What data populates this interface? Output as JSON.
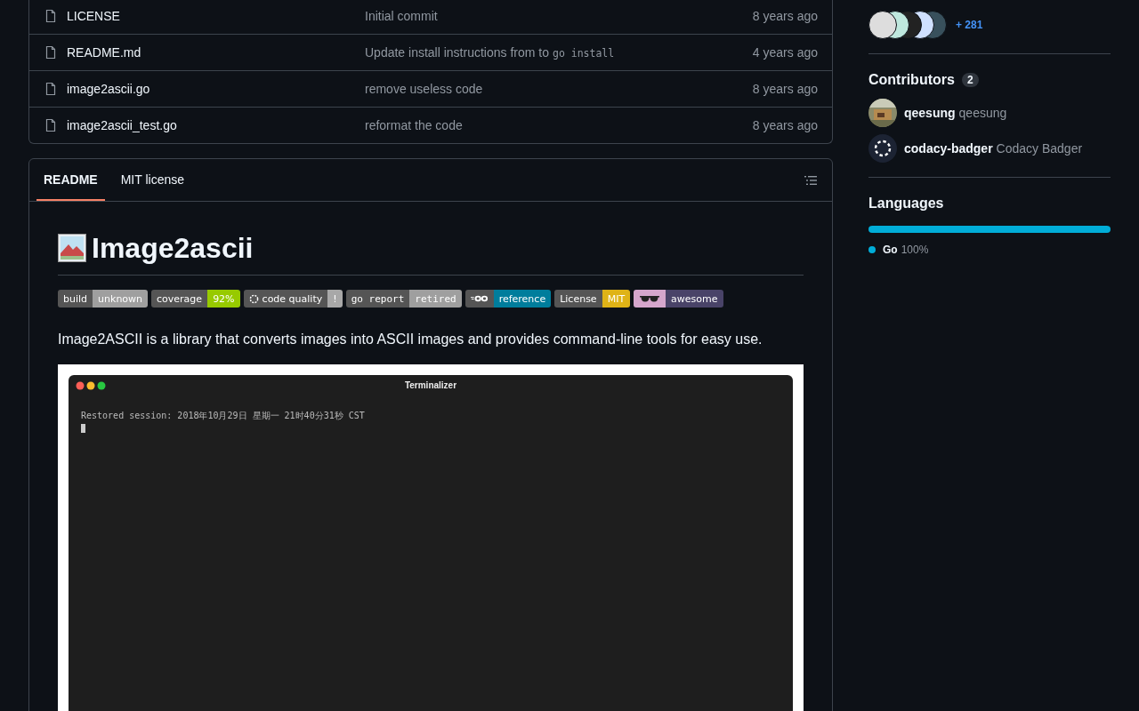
{
  "files": [
    {
      "name": "LICENSE",
      "message": "Initial commit",
      "time": "8 years ago"
    },
    {
      "name": "README.md",
      "message": "Update install instructions from to",
      "code": "go install",
      "time": "4 years ago"
    },
    {
      "name": "image2ascii.go",
      "message": "remove useless code",
      "time": "8 years ago"
    },
    {
      "name": "image2ascii_test.go",
      "message": "reformat the code",
      "time": "8 years ago"
    }
  ],
  "readme": {
    "tabs": [
      {
        "label": "README",
        "selected": true
      },
      {
        "label": "MIT license",
        "selected": false
      }
    ],
    "heading": "Image2ascii",
    "badges": [
      {
        "kind": "plain",
        "label": "build",
        "value": "unknown",
        "color": "#9f9f9f"
      },
      {
        "kind": "plain",
        "label": "coverage",
        "value": "92%",
        "color": "#97ca00"
      },
      {
        "kind": "codacy",
        "label": "code quality",
        "value": "!",
        "color": "#a8a8a8"
      },
      {
        "kind": "plain",
        "label": "go report",
        "value": "retired",
        "color": "#9f9f9f"
      },
      {
        "kind": "go",
        "value": "reference",
        "color": "#007d9c"
      },
      {
        "kind": "plain",
        "label": "License",
        "value": "MIT",
        "color": "#dfb317"
      },
      {
        "kind": "glasses",
        "value": "awesome",
        "color": "#494368"
      }
    ],
    "paragraph": "Image2ASCII is a library that converts images into ASCII images and provides command-line tools for easy use.",
    "terminal": {
      "title": "Terminalizer",
      "line": "Restored session: 2018年10月29日 星期一 21时40分31秒 CST"
    }
  },
  "sidebar": {
    "contributors_more": "+ 281",
    "contributors": {
      "title": "Contributors",
      "count": "2",
      "items": [
        {
          "login": "qeesung",
          "name": "qeesung",
          "kind": "photo"
        },
        {
          "login": "codacy-badger",
          "name": "Codacy Badger",
          "kind": "codacy"
        }
      ]
    },
    "languages": {
      "title": "Languages",
      "items": [
        {
          "name": "Go",
          "percent": "100%",
          "color": "#00add8",
          "level": 1
        }
      ]
    }
  }
}
